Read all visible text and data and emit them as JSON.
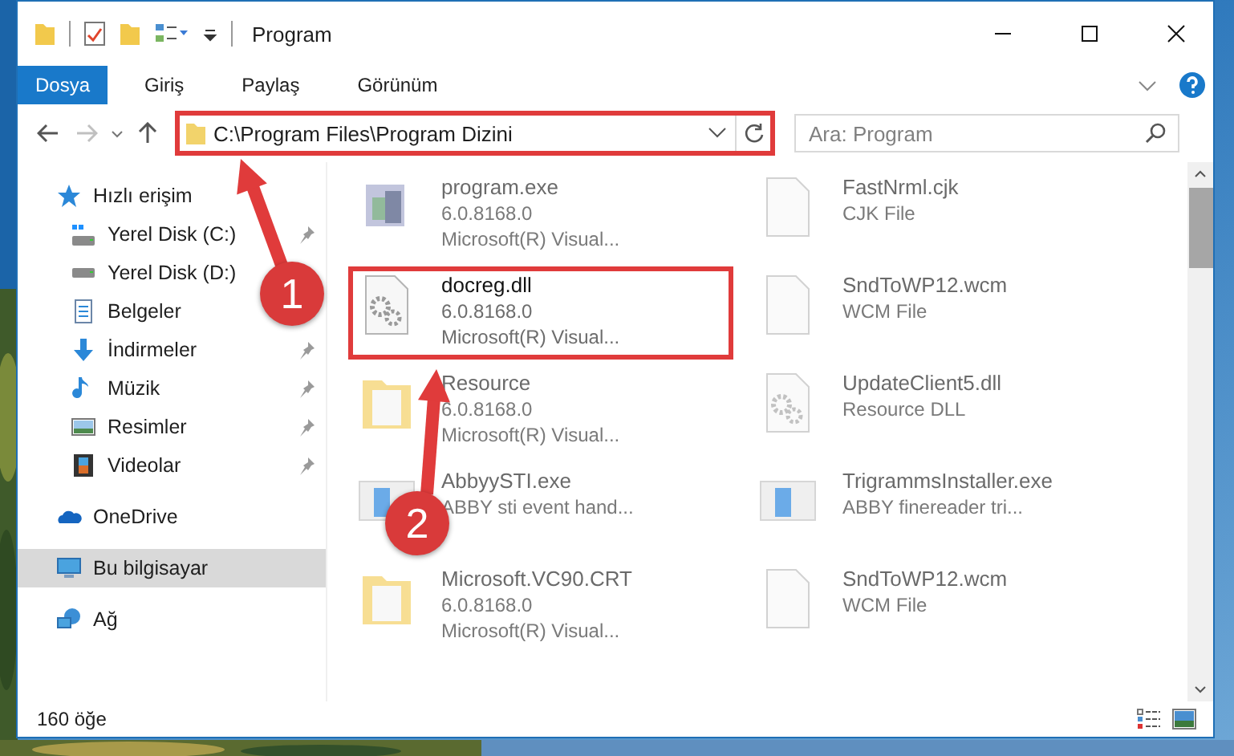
{
  "window": {
    "title": "Program"
  },
  "ribbon": {
    "file_button": "Dosya",
    "tabs": [
      {
        "label": "Giriş",
        "selected": false
      },
      {
        "label": "Paylaş",
        "selected": false
      },
      {
        "label": "Görünüm",
        "selected": false
      }
    ]
  },
  "address_bar": {
    "path": "C:\\Program Files\\Program Dizini",
    "highlighted": true
  },
  "search": {
    "placeholder": "Ara: Program"
  },
  "navigation": [
    {
      "label": "Hızlı erişim",
      "kind": "quick_access",
      "selected": false,
      "children": [
        {
          "label": "Yerel Disk (C:)",
          "kind": "drive_system",
          "selected": false,
          "pinned": true
        },
        {
          "label": "Yerel Disk (D:)",
          "kind": "drive",
          "selected": false
        },
        {
          "label": "Belgeler",
          "kind": "documents",
          "selected": false
        },
        {
          "label": "İndirmeler",
          "kind": "downloads",
          "selected": false,
          "pinned": true
        },
        {
          "label": "Müzik",
          "kind": "music",
          "selected": false,
          "pinned": true
        },
        {
          "label": "Resimler",
          "kind": "pictures",
          "selected": false,
          "pinned": true
        },
        {
          "label": "Videolar",
          "kind": "videos",
          "selected": false,
          "pinned": true
        }
      ]
    },
    {
      "label": "OneDrive",
      "kind": "cloud",
      "selected": false
    },
    {
      "label": "Bu bilgisayar",
      "kind": "computer",
      "selected": true
    },
    {
      "label": "Ağ",
      "kind": "network",
      "selected": false
    }
  ],
  "files": [
    {
      "name": "program.exe",
      "details": [
        "6.0.8168.0",
        "Microsoft(R) Visual..."
      ],
      "kind": "program",
      "blurred": true,
      "highlighted": false
    },
    {
      "name": "FastNrml.cjk",
      "details": [
        "CJK File"
      ],
      "kind": "file",
      "blurred": true,
      "highlighted": false
    },
    {
      "name": "docreg.dll",
      "details": [
        "6.0.8168.0",
        "Microsoft(R) Visual..."
      ],
      "kind": "dll",
      "blurred": false,
      "highlighted": true
    },
    {
      "name": "SndToWP12.wcm",
      "details": [
        "WCM File"
      ],
      "kind": "file",
      "blurred": true,
      "highlighted": false
    },
    {
      "name": "Resource",
      "details": [
        "6.0.8168.0",
        "Microsoft(R) Visual..."
      ],
      "kind": "folder",
      "blurred": true,
      "highlighted": false
    },
    {
      "name": "UpdateClient5.dll",
      "details": [
        "Resource DLL"
      ],
      "kind": "dll",
      "blurred": true,
      "highlighted": false
    },
    {
      "name": "AbbyySTI.exe",
      "details": [
        "ABBY sti event hand..."
      ],
      "kind": "installer",
      "blurred": true,
      "highlighted": false
    },
    {
      "name": "TrigrammsInstaller.exe",
      "details": [
        "ABBY finereader tri..."
      ],
      "kind": "installer",
      "blurred": true,
      "highlighted": false
    },
    {
      "name": "Microsoft.VC90.CRT",
      "details": [
        "6.0.8168.0",
        "Microsoft(R) Visual..."
      ],
      "kind": "folder",
      "blurred": true,
      "highlighted": false
    },
    {
      "name": "SndToWP12.wcm",
      "details": [
        "WCM File"
      ],
      "kind": "file",
      "blurred": true,
      "highlighted": false
    }
  ],
  "status_bar": {
    "item_count": "160 öğe"
  },
  "annotations": [
    {
      "label": "1"
    },
    {
      "label": "2"
    }
  ]
}
